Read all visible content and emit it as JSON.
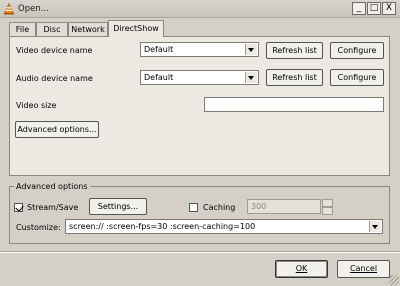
{
  "window": {
    "title": "Open...",
    "controls": {
      "minimize": "_",
      "maximize": "□",
      "close": "X"
    }
  },
  "tabs": [
    {
      "label": "File"
    },
    {
      "label": "Disc"
    },
    {
      "label": "Network"
    },
    {
      "label": "DirectShow",
      "active": true
    }
  ],
  "directshow": {
    "video_device_label": "Video device name",
    "video_device_value": "Default",
    "audio_device_label": "Audio device name",
    "audio_device_value": "Default",
    "refresh_label": "Refresh list",
    "configure_label": "Configure",
    "video_size_label": "Video size",
    "video_size_value": "",
    "advanced_button": "Advanced options..."
  },
  "advanced": {
    "group_title": "Advanced options",
    "stream_save_label": "Stream/Save",
    "stream_save_checked": true,
    "settings_button": "Settings...",
    "caching_label": "Caching",
    "caching_checked": false,
    "caching_value": "300",
    "customize_label": "Customize:",
    "customize_value": "screen:// :screen-fps=30 :screen-caching=100"
  },
  "footer": {
    "ok_label": "OK",
    "cancel_label": "Cancel"
  }
}
